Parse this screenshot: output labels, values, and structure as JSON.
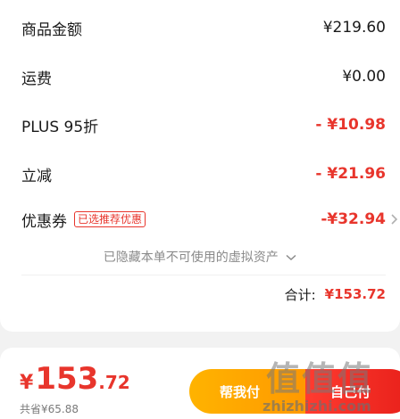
{
  "summary": {
    "rows": [
      {
        "label": "商品金额",
        "value": "¥219.60"
      },
      {
        "label": "运费",
        "value": "¥0.00"
      },
      {
        "label": "PLUS 95折",
        "value": "- ¥10.98"
      },
      {
        "label": "立减",
        "value": "- ¥21.96"
      },
      {
        "label": "优惠券",
        "value": "-¥32.94",
        "tag": "已选推荐优惠"
      }
    ],
    "hidden_note": "已隐藏本单不可使用的虚拟资产",
    "total_label": "合计:",
    "total_value": "¥153.72"
  },
  "bottom": {
    "price_symbol": "¥",
    "price_int": "153",
    "price_dec": ".72",
    "saved_text": "共省¥65.88",
    "help_pay_label": "帮我付",
    "pay_label": "自己付"
  },
  "watermark": {
    "glyphs": "值值值",
    "url": "zhizhizhi.com"
  },
  "colors": {
    "accent_red": "#e8352c",
    "help_button": "#ffa500",
    "background": "#f2f2f2"
  }
}
